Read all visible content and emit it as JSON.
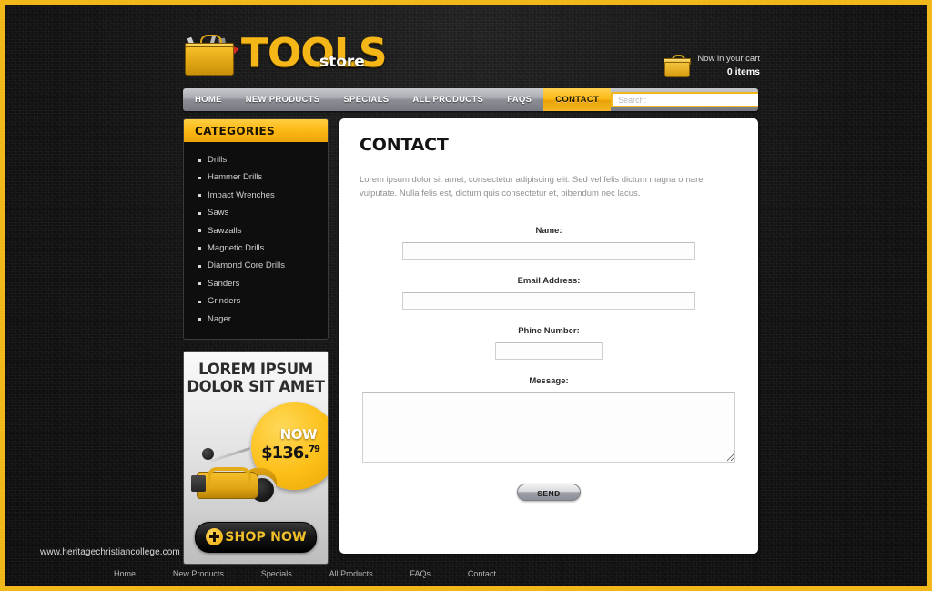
{
  "site": {
    "logo": {
      "main": "TOOL",
      "sub": "store",
      "tail": "S"
    },
    "cart": {
      "label": "Now in your cart",
      "count": "0 items",
      "icon": "basket-icon"
    }
  },
  "nav": {
    "items": [
      {
        "label": "HOME",
        "active": false
      },
      {
        "label": "NEW PRODUCTS",
        "active": false
      },
      {
        "label": "SPECIALS",
        "active": false
      },
      {
        "label": "ALL PRODUCTS",
        "active": false
      },
      {
        "label": "FAQS",
        "active": false
      },
      {
        "label": "CONTACT",
        "active": true
      }
    ]
  },
  "search": {
    "placeholder": "Search:",
    "value": "",
    "icon": "search-input"
  },
  "sidebar": {
    "title": "CATEGORIES",
    "items": [
      {
        "label": "Drills"
      },
      {
        "label": "Hammer Drills"
      },
      {
        "label": "Impact Wrenches"
      },
      {
        "label": "Saws"
      },
      {
        "label": "Sawzalls"
      },
      {
        "label": "Magnetic Drills"
      },
      {
        "label": "Diamond Core Drills"
      },
      {
        "label": "Sanders"
      },
      {
        "label": "Grinders"
      },
      {
        "label": "Nager"
      }
    ]
  },
  "promo": {
    "line1": "LOREM IPSUM",
    "line2": "DOLOR SIT AMET",
    "badge": "NOW",
    "price_main": "$136.",
    "price_cents": "79",
    "button_label": "SHOP NOW"
  },
  "main": {
    "title": "CONTACT",
    "intro": "Lorem ipsum dolor sit amet, consectetur adipiscing elit. Sed vel felis dictum magna ornare vulputate. Nulla felis est, dictum quis consectetur et, bibendum nec lacus.",
    "form": {
      "name_label": "Name:",
      "name_value": "",
      "email_label": "Email Address:",
      "email_value": "",
      "phone_label": "Phine Number:",
      "phone_value": "",
      "message_label": "Message:",
      "message_value": "",
      "send_label": "SEND"
    }
  },
  "footer": {
    "links": [
      {
        "label": "Home"
      },
      {
        "label": "New Products"
      },
      {
        "label": "Specials"
      },
      {
        "label": "All Products"
      },
      {
        "label": "FAQs"
      },
      {
        "label": "Contact"
      }
    ]
  },
  "watermark": "www.heritagechristiancollege.com",
  "colors": {
    "accent_gold": "#fcb813",
    "frame_gold": "#f0b818",
    "background_dark": "#141414",
    "panel_white": "#ffffff"
  }
}
